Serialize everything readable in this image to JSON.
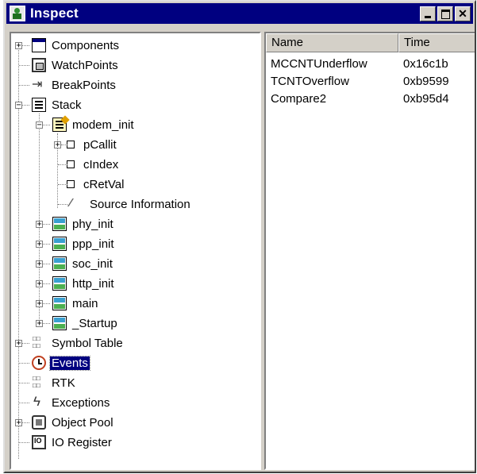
{
  "window": {
    "title": "Inspect"
  },
  "tree": {
    "nodes": [
      {
        "label": "Components"
      },
      {
        "label": "WatchPoints"
      },
      {
        "label": "BreakPoints"
      },
      {
        "label": "Stack"
      },
      {
        "label": "modem_init"
      },
      {
        "label": "pCallit"
      },
      {
        "label": "cIndex"
      },
      {
        "label": "cRetVal"
      },
      {
        "label": "Source Information"
      },
      {
        "label": "phy_init"
      },
      {
        "label": "ppp_init"
      },
      {
        "label": "soc_init"
      },
      {
        "label": "http_init"
      },
      {
        "label": "main"
      },
      {
        "label": "_Startup"
      },
      {
        "label": "Symbol Table"
      },
      {
        "label": "Events"
      },
      {
        "label": "RTK"
      },
      {
        "label": "Exceptions"
      },
      {
        "label": "Object Pool"
      },
      {
        "label": "IO Register"
      }
    ],
    "selected": "Events"
  },
  "list": {
    "columns": [
      "Name",
      "Time"
    ],
    "rows": [
      [
        "MCCNTUnderflow",
        "0x16c1b"
      ],
      [
        "TCNTOverflow",
        "0xb9599"
      ],
      [
        "Compare2",
        "0xb95d4"
      ]
    ]
  }
}
